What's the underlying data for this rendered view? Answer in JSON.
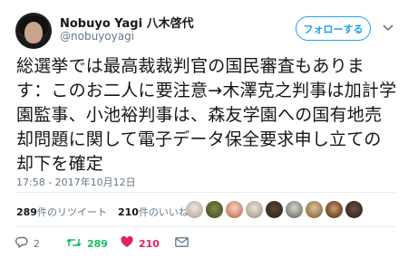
{
  "user": {
    "name": "Nobuyo Yagi 八木啓代",
    "handle": "@nobuyoyagi"
  },
  "follow_button": {
    "label": "フォローする"
  },
  "tweet": {
    "text": "総選挙では最高裁裁判官の国民審査もあります：このお二人に要注意→木澤克之判事は加計学園監事、小池裕判事は、森友学園への国有地売却問題に関して電子データ保全要求申し立ての却下を確定",
    "timestamp": "17:58 - 2017年10月12日"
  },
  "stats": {
    "retweets_count": "289",
    "retweets_label": "件のリツイート",
    "likes_count": "210",
    "likes_label": "件のいいね"
  },
  "likers": [
    "liker-1",
    "liker-2",
    "liker-3",
    "liker-4",
    "liker-5",
    "liker-6",
    "liker-7",
    "liker-8",
    "liker-9"
  ],
  "actions": {
    "replies": "2",
    "retweets": "289",
    "likes": "210"
  },
  "icons": {
    "caret": "chevron-down-icon",
    "reply": "reply-icon",
    "retweet": "retweet-icon",
    "like": "heart-icon",
    "dm": "envelope-icon"
  },
  "colors": {
    "accent": "#1da1f2",
    "retweet": "#17bf63",
    "like": "#e0245e",
    "muted": "#657786"
  }
}
